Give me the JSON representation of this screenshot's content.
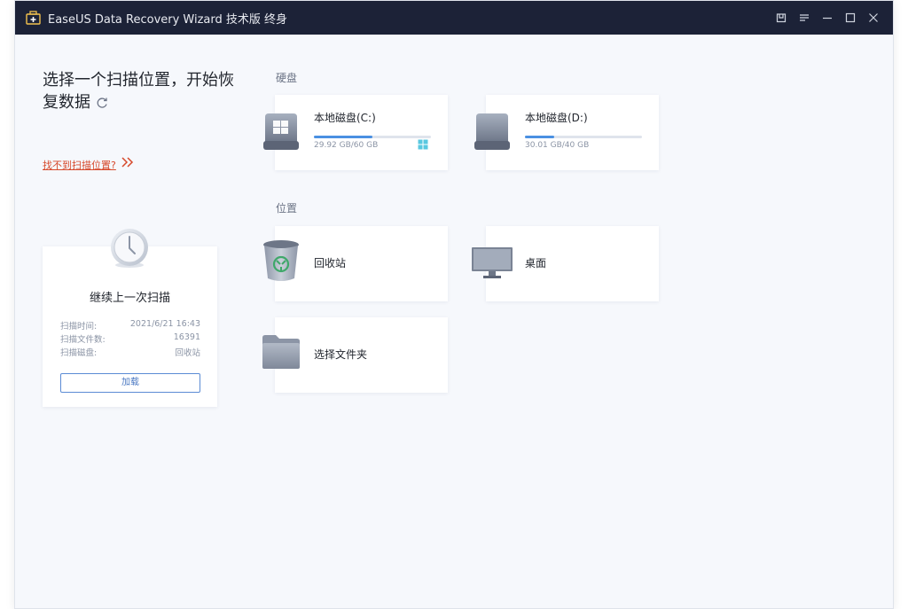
{
  "window": {
    "title": "EaseUS Data Recovery Wizard 技术版 终身"
  },
  "left": {
    "title": "选择一个扫描位置，开始恢复数据",
    "help_link": "找不到扫描位置?",
    "resume": {
      "title": "继续上一次扫描",
      "rows": [
        {
          "label": "扫描时间:",
          "value": "2021/6/21 16:43"
        },
        {
          "label": "扫描文件数:",
          "value": "16391"
        },
        {
          "label": "扫描磁盘:",
          "value": "回收站"
        }
      ],
      "load_label": "加载"
    }
  },
  "drives_section": {
    "label": "硬盘",
    "drives": [
      {
        "name": "本地磁盘(C:)",
        "size_text": "29.92 GB/60 GB",
        "used_fraction": 0.4987
      },
      {
        "name": "本地磁盘(D:)",
        "size_text": "30.01 GB/40 GB",
        "used_fraction": 0.2497
      }
    ]
  },
  "locations_section": {
    "label": "位置",
    "items": [
      {
        "name": "回收站"
      },
      {
        "name": "桌面"
      },
      {
        "name": "选择文件夹"
      }
    ]
  },
  "colors": {
    "titlebar": "#1c2237",
    "accent": "#4a90e2",
    "link": "#d6492b"
  },
  "icons": [
    "app-icon",
    "restore-icon",
    "menu-icon",
    "minimize-icon",
    "maximize-icon",
    "close-icon",
    "refresh-icon",
    "double-chevron-icon",
    "clock-icon",
    "drive-icon",
    "windows-logo-icon",
    "recycle-bin-icon",
    "monitor-icon",
    "folder-icon"
  ]
}
